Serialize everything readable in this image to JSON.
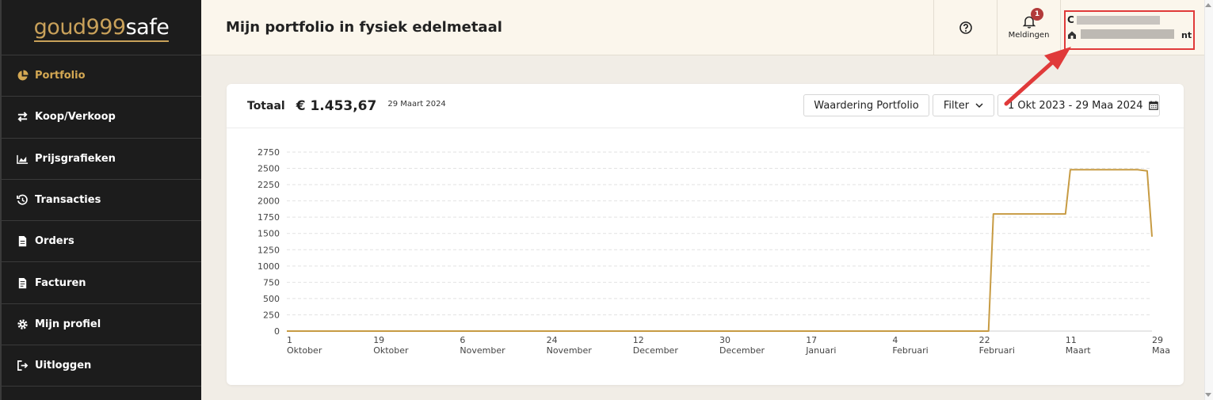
{
  "logo": {
    "part1": "goud999",
    "part2": "safe"
  },
  "sidebar": {
    "items": [
      {
        "label": "Portfolio",
        "icon": "pie-chart-icon",
        "active": true
      },
      {
        "label": "Koop/Verkoop",
        "icon": "exchange-arrows-icon",
        "active": false
      },
      {
        "label": "Prijsgrafieken",
        "icon": "area-chart-icon",
        "active": false
      },
      {
        "label": "Transacties",
        "icon": "history-icon",
        "active": false
      },
      {
        "label": "Orders",
        "icon": "document-icon",
        "active": false
      },
      {
        "label": "Facturen",
        "icon": "invoice-icon",
        "active": false
      },
      {
        "label": "Mijn profiel",
        "icon": "gear-icon",
        "active": false
      },
      {
        "label": "Uitloggen",
        "icon": "logout-icon",
        "active": false
      }
    ]
  },
  "header": {
    "title": "Mijn portfolio in fysiek edelmetaal",
    "notifications_label": "Meldingen",
    "notifications_count": "1",
    "user_name_fragment": "C",
    "user_company_fragment": "nt"
  },
  "card": {
    "total_label": "Totaal",
    "total_value": "€ 1.453,67",
    "total_date": "29 Maart 2024",
    "waardering_button": "Waardering Portfolio",
    "filter_button": "Filter",
    "date_range": "1 Okt 2023 - 29 Maa 2024"
  },
  "colors": {
    "accent": "#c9a15a",
    "sidebar_bg": "#1c1c1c",
    "line": "#c79b43",
    "highlight_box": "#e03a3a"
  },
  "chart_data": {
    "type": "line",
    "ylim": [
      0,
      2750
    ],
    "yticks": [
      0,
      250,
      500,
      750,
      1000,
      1250,
      1500,
      1750,
      2000,
      2250,
      2500,
      2750
    ],
    "xticks": [
      {
        "date": "2023-10-01",
        "l1": "1",
        "l2": "Oktober"
      },
      {
        "date": "2023-10-19",
        "l1": "19",
        "l2": "Oktober"
      },
      {
        "date": "2023-11-06",
        "l1": "6",
        "l2": "November"
      },
      {
        "date": "2023-11-24",
        "l1": "24",
        "l2": "November"
      },
      {
        "date": "2023-12-12",
        "l1": "12",
        "l2": "December"
      },
      {
        "date": "2023-12-30",
        "l1": "30",
        "l2": "December"
      },
      {
        "date": "2024-01-17",
        "l1": "17",
        "l2": "Januari"
      },
      {
        "date": "2024-02-04",
        "l1": "4",
        "l2": "Februari"
      },
      {
        "date": "2024-02-22",
        "l1": "22",
        "l2": "Februari"
      },
      {
        "date": "2024-03-11",
        "l1": "11",
        "l2": "Maart"
      },
      {
        "date": "2024-03-29",
        "l1": "29",
        "l2": "Maa"
      }
    ],
    "grid": true,
    "series": [
      {
        "points": [
          [
            "2023-10-01",
            0
          ],
          [
            "2024-02-22",
            0
          ],
          [
            "2024-02-24",
            0
          ],
          [
            "2024-02-25",
            1800
          ],
          [
            "2024-03-11",
            1800
          ],
          [
            "2024-03-12",
            2480
          ],
          [
            "2024-03-26",
            2480
          ],
          [
            "2024-03-28",
            2460
          ],
          [
            "2024-03-29",
            1450
          ]
        ]
      }
    ]
  }
}
